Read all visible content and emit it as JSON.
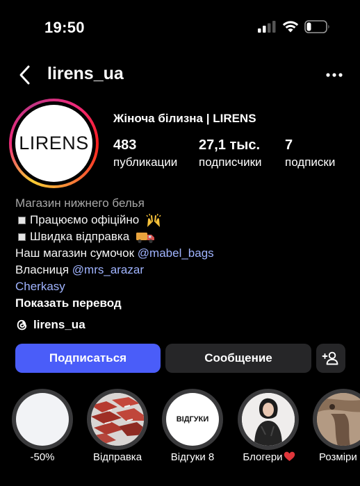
{
  "status_bar": {
    "time": "19:50"
  },
  "header": {
    "username": "lirens_ua"
  },
  "profile": {
    "avatar_text": "LIRENS",
    "full_name": "Жіноча білизна | LIRENS",
    "stats": [
      {
        "value": "483",
        "label": "публикации"
      },
      {
        "value": "27,1 тыс.",
        "label": "подписчики"
      },
      {
        "value": "7",
        "label": "подписки"
      }
    ]
  },
  "bio": {
    "category": "Магазин нижнего белья",
    "line1": "Працюємо офіційно",
    "line2": "Швидка відправка",
    "bags_prefix": "Наш магазин сумочок",
    "bags_handle": "@mabel_bags",
    "owner_prefix": "Власниця",
    "owner_handle": "@mrs_arazar",
    "city": "Cherkasy",
    "translate": "Показать перевод"
  },
  "threads": {
    "handle": "lirens_ua"
  },
  "buttons": {
    "follow": "Подписаться",
    "message": "Сообщение"
  },
  "highlights": [
    {
      "label": "-50%"
    },
    {
      "label": "Відправка"
    },
    {
      "label": "Відгуки 8",
      "cover_text": "ВІДГУКИ"
    },
    {
      "label": "Блогери"
    },
    {
      "label": "Розміри"
    }
  ],
  "colors": {
    "follow_button": "#4a5df9",
    "link": "#a0b4ff",
    "secondary_button": "#262628"
  },
  "icons": [
    "signal-icon",
    "wifi-icon",
    "battery-icon",
    "back-chevron-icon",
    "more-icon",
    "threads-icon",
    "add-user-icon",
    "heart-icon"
  ]
}
